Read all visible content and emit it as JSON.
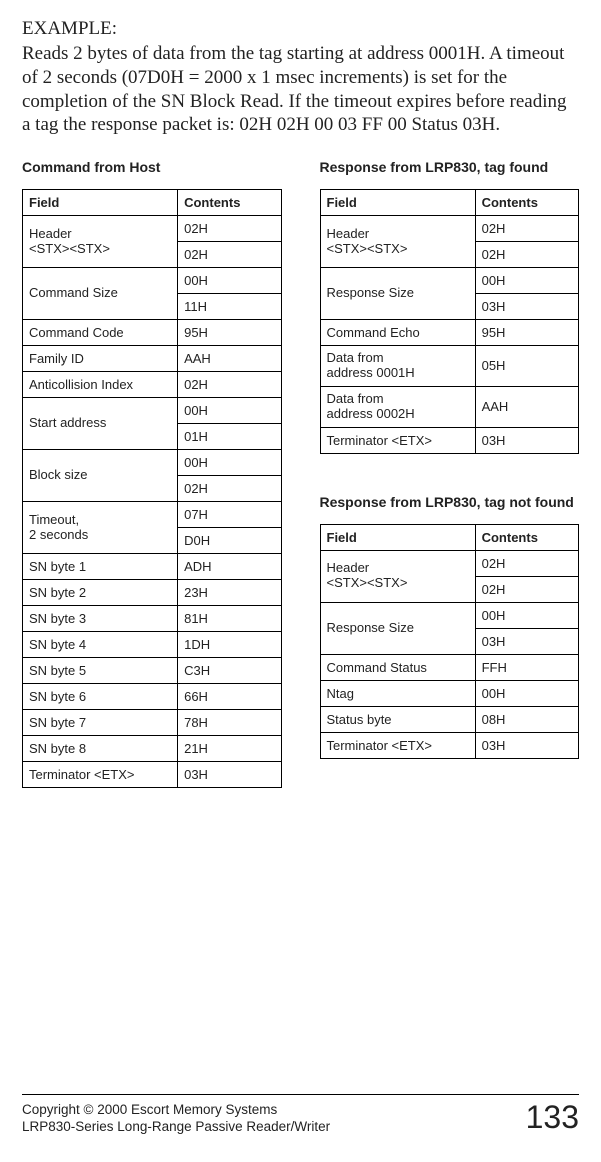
{
  "intro": {
    "heading": "EXAMPLE:",
    "body": "Reads 2 bytes of data from the tag starting at address 0001H. A timeout of 2 seconds (07D0H = 2000 x 1 msec increments) is set for the completion of the SN Block Read.  If the timeout expires before reading a tag the response packet is:  02H 02H 00 03 FF 00 Status 03H."
  },
  "tables": {
    "command": {
      "title": "Command from Host",
      "head": {
        "c1": "Field",
        "c2": "Contents"
      },
      "rows": [
        {
          "f": "Header\n<STX><STX>",
          "c": "02H",
          "merge2": true
        },
        {
          "f": "",
          "c": "02H"
        },
        {
          "f": "Command Size",
          "c": "00H",
          "merge2": true
        },
        {
          "f": "",
          "c": "11H"
        },
        {
          "f": "Command Code",
          "c": "95H"
        },
        {
          "f": "Family ID",
          "c": "AAH"
        },
        {
          "f": "Anticollision Index",
          "c": "02H"
        },
        {
          "f": "Start address",
          "c": "00H",
          "merge2": true
        },
        {
          "f": "",
          "c": "01H"
        },
        {
          "f": "Block size",
          "c": "00H",
          "merge2": true
        },
        {
          "f": "",
          "c": "02H"
        },
        {
          "f": "Timeout,\n2 seconds",
          "c": "07H",
          "merge2": true
        },
        {
          "f": "",
          "c": "D0H"
        },
        {
          "f": "SN byte 1",
          "c": "ADH"
        },
        {
          "f": "SN byte 2",
          "c": "23H"
        },
        {
          "f": "SN byte 3",
          "c": "81H"
        },
        {
          "f": "SN byte 4",
          "c": "1DH"
        },
        {
          "f": "SN byte 5",
          "c": "C3H"
        },
        {
          "f": "SN byte 6",
          "c": "66H"
        },
        {
          "f": "SN byte 7",
          "c": "78H"
        },
        {
          "f": "SN byte 8",
          "c": "21H"
        },
        {
          "f": "Terminator <ETX>",
          "c": "03H"
        }
      ]
    },
    "respFound": {
      "title": "Response from LRP830, tag found",
      "head": {
        "c1": "Field",
        "c2": "Contents"
      },
      "rows": [
        {
          "f": "Header\n<STX><STX>",
          "c": "02H",
          "merge2": true
        },
        {
          "f": "",
          "c": "02H"
        },
        {
          "f": "Response Size",
          "c": "00H",
          "merge2": true
        },
        {
          "f": "",
          "c": "03H"
        },
        {
          "f": "Command Echo",
          "c": "95H"
        },
        {
          "f": "Data from\naddress 0001H",
          "c": "05H"
        },
        {
          "f": "Data from\naddress 0002H",
          "c": "AAH"
        },
        {
          "f": "Terminator <ETX>",
          "c": "03H"
        }
      ]
    },
    "respNotFound": {
      "title": "Response from LRP830, tag not found",
      "head": {
        "c1": "Field",
        "c2": "Contents"
      },
      "rows": [
        {
          "f": "Header\n<STX><STX>",
          "c": "02H",
          "merge2": true
        },
        {
          "f": "",
          "c": "02H"
        },
        {
          "f": "Response Size",
          "c": "00H",
          "merge2": true
        },
        {
          "f": "",
          "c": "03H"
        },
        {
          "f": "Command Status",
          "c": "FFH"
        },
        {
          "f": "Ntag",
          "c": "00H"
        },
        {
          "f": "Status byte",
          "c": "08H"
        },
        {
          "f": "Terminator <ETX>",
          "c": "03H"
        }
      ]
    }
  },
  "footer": {
    "line1": "Copyright © 2000 Escort Memory Systems",
    "line2": "LRP830-Series Long-Range Passive Reader/Writer",
    "page": "133"
  }
}
